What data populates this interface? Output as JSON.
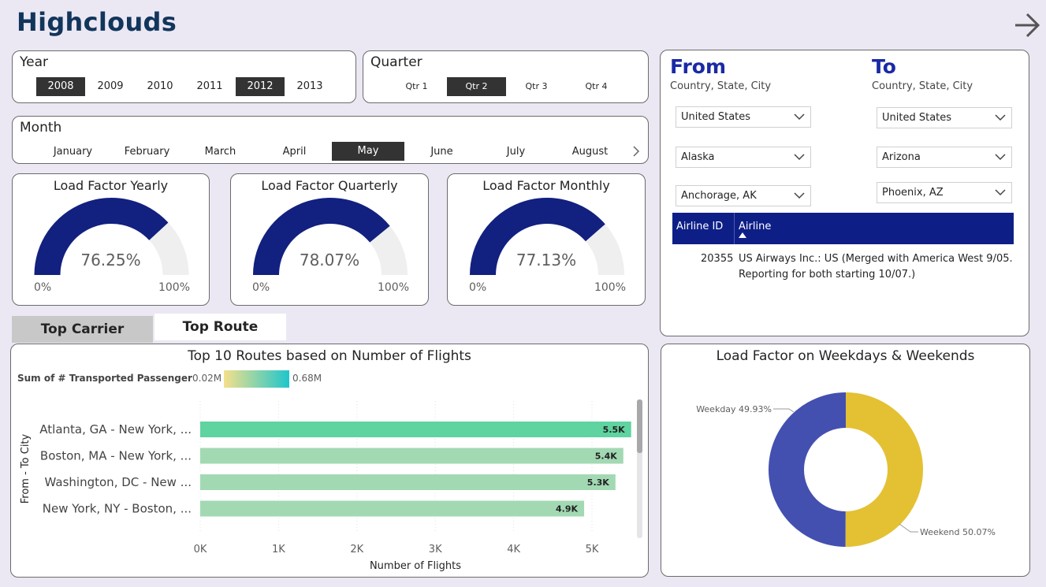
{
  "app": {
    "title": "Highclouds"
  },
  "slicers": {
    "year": {
      "title": "Year",
      "options": [
        "2008",
        "2009",
        "2010",
        "2011",
        "2012",
        "2013"
      ],
      "selected": [
        "2008",
        "2012"
      ]
    },
    "quarter": {
      "title": "Quarter",
      "options": [
        "Qtr 1",
        "Qtr 2",
        "Qtr 3",
        "Qtr 4"
      ],
      "selected": [
        "Qtr 2"
      ]
    },
    "month": {
      "title": "Month",
      "options": [
        "January",
        "February",
        "March",
        "April",
        "May",
        "June",
        "July",
        "August"
      ],
      "selected": [
        "May"
      ]
    }
  },
  "gauges": [
    {
      "title": "Load Factor Yearly",
      "value_label": "76.25%",
      "value": 76.25,
      "min_label": "0%",
      "max_label": "100%"
    },
    {
      "title": "Load Factor Quarterly",
      "value_label": "78.07%",
      "value": 78.07,
      "min_label": "0%",
      "max_label": "100%"
    },
    {
      "title": "Load Factor Monthly",
      "value_label": "77.13%",
      "value": 77.13,
      "min_label": "0%",
      "max_label": "100%"
    }
  ],
  "route_filter": {
    "from": {
      "title": "From",
      "subtitle": "Country, State, City",
      "country": "United States",
      "state": "Alaska",
      "city": "Anchorage, AK"
    },
    "to": {
      "title": "To",
      "subtitle": "Country, State, City",
      "country": "United States",
      "state": "Arizona",
      "city": "Phoenix, AZ"
    },
    "table": {
      "headers": [
        "Airline ID",
        "Airline"
      ],
      "rows": [
        {
          "airline_id": "20355",
          "airline_line1": "US Airways Inc.: US (Merged with America West 9/05.",
          "airline_line2": "Reporting for both starting 10/07.)"
        }
      ]
    }
  },
  "tabs": {
    "top_carrier": "Top Carrier",
    "top_route": "Top Route"
  },
  "routes_chart": {
    "legend_title": "Sum of # Transported Passenger",
    "legend_min": "0.02M",
    "legend_max": "0.68M",
    "colors": {
      "grad_low": "#f5e08a",
      "grad_high": "#1ec6cc",
      "bar_top": "#5fd3a0",
      "bar": "#a2d9b3"
    }
  },
  "weekday_chart": {},
  "chart_data": [
    {
      "type": "bar",
      "title": "Top 10 Routes based on Number of Flights",
      "orientation": "horizontal",
      "categories": [
        "Atlanta, GA - New York, ...",
        "Boston, MA - New York, ...",
        "Washington, DC - New ...",
        "New York, NY - Boston, ..."
      ],
      "values": [
        5500,
        5400,
        5300,
        4900
      ],
      "data_labels": [
        "5.5K",
        "5.4K",
        "5.3K",
        "4.9K"
      ],
      "xlabel": "Number of Flights",
      "ylabel": "From - To City",
      "xticks": [
        "0K",
        "1K",
        "2K",
        "3K",
        "4K",
        "5K"
      ],
      "xlim": [
        0,
        5500
      ],
      "grid": true
    },
    {
      "type": "pie",
      "title": "Load Factor on Weekdays & Weekends",
      "donut": true,
      "categories": [
        "Weekday",
        "Weekend"
      ],
      "values": [
        49.93,
        50.07
      ],
      "data_labels": [
        "Weekday 49.93%",
        "Weekend 50.07%"
      ],
      "colors": [
        "#4350b0",
        "#e3c133"
      ]
    }
  ]
}
